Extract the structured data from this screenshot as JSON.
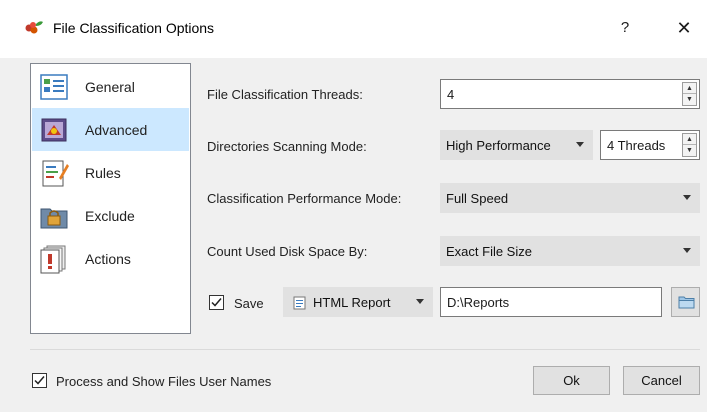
{
  "window": {
    "title": "File Classification Options",
    "help_label": "?",
    "close_label": "✕",
    "title_icon": "grapes-icon"
  },
  "sidebar": {
    "items": [
      {
        "label": "General",
        "icon": "general-icon",
        "selected": false
      },
      {
        "label": "Advanced",
        "icon": "advanced-icon",
        "selected": true
      },
      {
        "label": "Rules",
        "icon": "rules-icon",
        "selected": false
      },
      {
        "label": "Exclude",
        "icon": "lock-icon",
        "selected": false
      },
      {
        "label": "Actions",
        "icon": "actions-icon",
        "selected": false
      }
    ]
  },
  "settings": {
    "threads_label": "File Classification Threads:",
    "threads_value": "4",
    "scan_mode_label": "Directories Scanning Mode:",
    "scan_mode_value": "High Performance",
    "scan_threads_value": "4 Threads",
    "perf_mode_label": "Classification Performance Mode:",
    "perf_mode_value": "Full Speed",
    "disk_space_label": "Count Used Disk Space By:",
    "disk_space_value": "Exact File Size",
    "save_label": "Save",
    "save_checked": true,
    "report_type_value": "HTML Report",
    "report_path_value": "D:\\Reports"
  },
  "footer": {
    "user_names_label": "Process and Show Files User Names",
    "user_names_checked": true,
    "ok_label": "Ok",
    "cancel_label": "Cancel"
  },
  "colors": {
    "selection": "#cce8ff",
    "window_bg": "#f0f0f0",
    "button_bg": "#e1e1e1"
  }
}
